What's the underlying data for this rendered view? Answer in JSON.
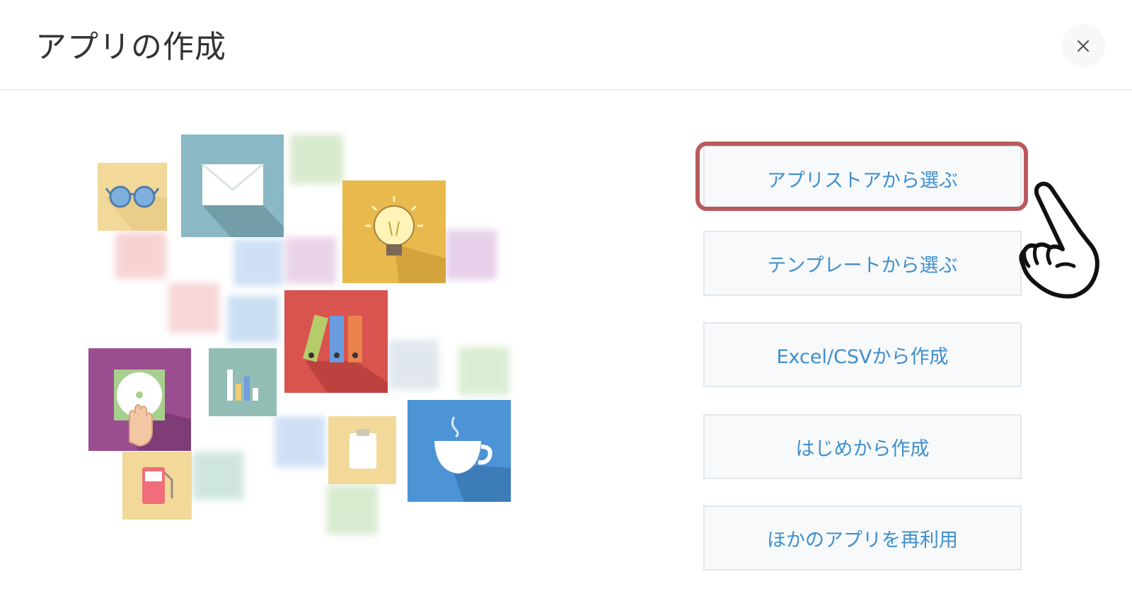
{
  "dialog": {
    "title": "アプリの作成"
  },
  "options": [
    {
      "label": "アプリストアから選ぶ"
    },
    {
      "label": "テンプレートから選ぶ"
    },
    {
      "label": "Excel/CSVから作成"
    },
    {
      "label": "はじめから作成"
    },
    {
      "label": "ほかのアプリを再利用"
    }
  ],
  "icons": {
    "close": "close-icon",
    "pointer": "pointing-hand-icon"
  },
  "colors": {
    "button_text": "#3f8fcc",
    "highlight": "#b95a5e"
  }
}
